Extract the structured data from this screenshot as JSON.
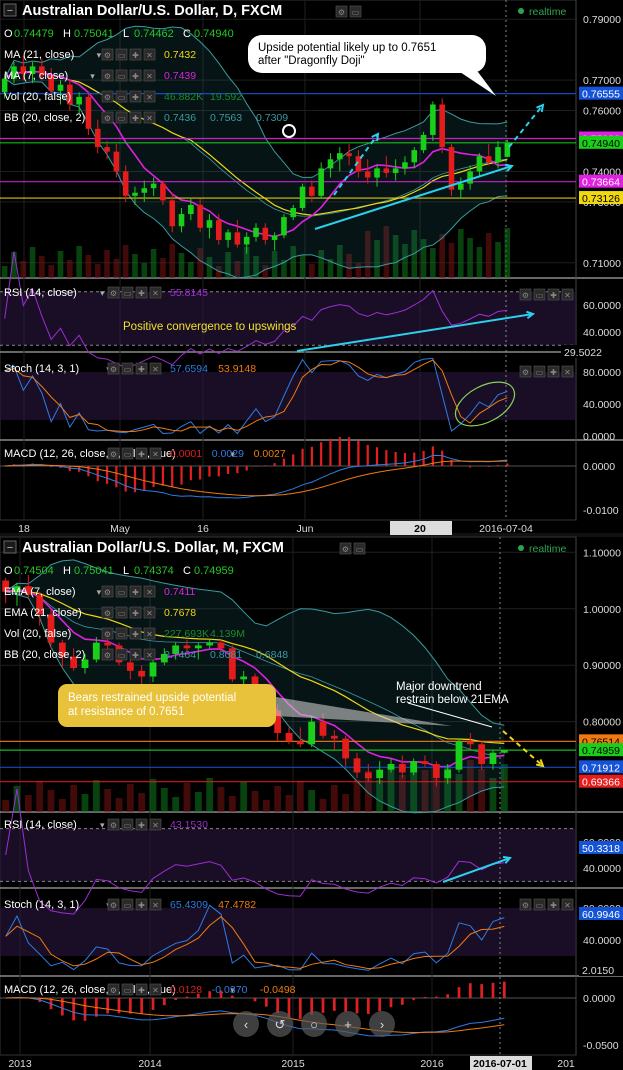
{
  "colors": {
    "bg": "#000000",
    "grid": "#1f1f1f",
    "sep": "#8a8a8a",
    "up": "#19cf19",
    "down": "#e41c1c",
    "ma21": "#f1d70f",
    "ma7": "#e020e0",
    "bb": "#3b9aa0",
    "rsi": "#9c2ed2",
    "stoch_k": "#2f7ce6",
    "stoch_d": "#f07a10",
    "macd": "#2f7ce6",
    "signal": "#f07a10",
    "hist": "#e02020",
    "vol": "#0f7a1c",
    "annot": "#2ad0ec",
    "yellow_arrow": "#f1d70f",
    "callout": "#e8c23a"
  },
  "daily": {
    "title": "Australian Dollar/U.S. Dollar, D, FXCM",
    "realtime": "realtime",
    "ohlc": {
      "O": "0.74479",
      "H": "0.75041",
      "L": "0.74462",
      "C": "0.74940"
    },
    "legend": [
      {
        "label": "MA (21, close)",
        "vals": [
          "0.7432"
        ],
        "colors": [
          "#f1d70f"
        ]
      },
      {
        "label": "MA (7, close)",
        "vals": [
          "0.7439"
        ],
        "colors": [
          "#e020e0"
        ]
      },
      {
        "label": "Vol (20, false)",
        "vals": [
          "46.882K",
          "19.592"
        ],
        "colors": [
          "#1b8a2a",
          "#1b8a2a"
        ]
      },
      {
        "label": "BB (20, close, 2)",
        "vals": [
          "0.7436",
          "0.7563",
          "0.7309"
        ],
        "colors": [
          "#3b9aa0",
          "#3b9aa0",
          "#3b9aa0"
        ]
      }
    ],
    "y_ticks": [
      "0.79000",
      "0.77000",
      "0.76000",
      "0.74000",
      "0.73000",
      "0.71000"
    ],
    "price_tags": [
      {
        "text": "0.76555",
        "bg": "#1452d8",
        "fg": "#ffffff",
        "v": 0.76555
      },
      {
        "text": "0.75082",
        "bg": "#e020e0",
        "fg": "#ffffff",
        "v": 0.75082
      },
      {
        "text": "0.74940",
        "bg": "#19cf19",
        "fg": "#000000",
        "v": 0.7494
      },
      {
        "text": "0.73664",
        "bg": "#e020e0",
        "fg": "#ffffff",
        "v": 0.73664
      },
      {
        "text": "0.73126",
        "bg": "#f1d70f",
        "fg": "#000000",
        "v": 0.73126
      }
    ],
    "hlines": [
      0.76555,
      0.75082,
      0.7494,
      0.73664,
      0.73126
    ],
    "callout": "Upside potential likely up to 0.7651\nafter \"Dragonfly Doji\"",
    "rsi": {
      "label": "RSI (14, close)",
      "value": "55.8145",
      "ticks": [
        "60.0000",
        "40.0000"
      ],
      "tag": "29.5022",
      "note": "Positive convergence to upswings"
    },
    "stoch": {
      "label": "Stoch (14, 3, 1)",
      "k": "57.6594",
      "d": "53.9148",
      "ticks": [
        "80.0000",
        "40.0000",
        "0.0000"
      ]
    },
    "macd": {
      "label": "MACD (12, 26, close, 9, false, true)",
      "v1": "0.0001",
      "v2": "0.0029",
      "v3": "0.0027",
      "ticks": [
        "0.0000",
        "-0.0100"
      ]
    },
    "x_labels": [
      "18",
      "May",
      "16",
      "Jun",
      "20",
      "2016-07-04"
    ]
  },
  "monthly": {
    "title": "Australian Dollar/U.S. Dollar, M, FXCM",
    "realtime": "realtime",
    "ohlc": {
      "O": "0.74504",
      "H": "0.75041",
      "L": "0.74374",
      "C": "0.74959"
    },
    "legend": [
      {
        "label": "EMA (7, close)",
        "vals": [
          "0.7411"
        ],
        "colors": [
          "#e020e0"
        ]
      },
      {
        "label": "EMA (21, close)",
        "vals": [
          "0.7678"
        ],
        "colors": [
          "#f1d70f"
        ]
      },
      {
        "label": "Vol (20, false)",
        "vals": [
          "227.693K",
          "4.139M"
        ],
        "colors": [
          "#1b8a2a",
          "#1b8a2a"
        ]
      },
      {
        "label": "BB (20, close, 2)",
        "vals": [
          "0.7464",
          "0.8081",
          "0.6848"
        ],
        "colors": [
          "#3b9aa0",
          "#3b9aa0",
          "#3b9aa0"
        ]
      }
    ],
    "y_ticks": [
      "1.10000",
      "1.00000",
      "0.90000",
      "0.80000"
    ],
    "price_tags": [
      {
        "text": "0.76514",
        "bg": "#f07a10",
        "fg": "#000000",
        "v": 0.76514
      },
      {
        "text": "0.74959",
        "bg": "#19cf19",
        "fg": "#000000",
        "v": 0.74959
      },
      {
        "text": "0.71912",
        "bg": "#1452d8",
        "fg": "#ffffff",
        "v": 0.71912
      },
      {
        "text": "0.69366",
        "bg": "#e41c1c",
        "fg": "#ffffff",
        "v": 0.69366
      }
    ],
    "hlines": [
      0.76514,
      0.74959,
      0.71912,
      0.69366
    ],
    "callout": "Bears restrained upside potential\nat resistance of 0.7651",
    "note": "Major downtrend\nrestrain below 21EMA",
    "rsi": {
      "label": "RSI (14, close)",
      "value": "43.1530",
      "ticks": [
        "60.0000",
        "40.0000"
      ],
      "tag": "50.3318"
    },
    "stoch": {
      "label": "Stoch (14, 3, 1)",
      "k": "65.4309",
      "d": "47.4782",
      "ticks": [
        "80.0000",
        "40.0000"
      ],
      "tag": "60.9946",
      "tag2": "2.0150"
    },
    "macd": {
      "label": "MACD (12, 26, close, 9, false, true)",
      "v1": "0.0128",
      "v2": "-0.0370",
      "v3": "-0.0498",
      "ticks": [
        "0.0000",
        "-0.0500"
      ]
    },
    "x_labels": [
      "2013",
      "2014",
      "2015",
      "2016",
      "2016-07-01",
      "201"
    ]
  },
  "chart_data": [
    {
      "type": "candlestick",
      "title": "Australian Dollar/U.S. Dollar, D, FXCM",
      "ylim": [
        0.705,
        0.795
      ],
      "candles": [
        [
          0.766,
          0.772,
          0.764,
          0.7705
        ],
        [
          0.7705,
          0.776,
          0.769,
          0.7745
        ],
        [
          0.7745,
          0.778,
          0.77,
          0.772
        ],
        [
          0.772,
          0.776,
          0.769,
          0.7745
        ],
        [
          0.7745,
          0.777,
          0.77,
          0.7715
        ],
        [
          0.7715,
          0.774,
          0.765,
          0.7665
        ],
        [
          0.7665,
          0.77,
          0.762,
          0.7685
        ],
        [
          0.7685,
          0.77,
          0.76,
          0.762
        ],
        [
          0.762,
          0.766,
          0.759,
          0.7645
        ],
        [
          0.7645,
          0.766,
          0.752,
          0.754
        ],
        [
          0.754,
          0.757,
          0.746,
          0.748
        ],
        [
          0.748,
          0.75,
          0.744,
          0.7465
        ],
        [
          0.7465,
          0.749,
          0.738,
          0.74
        ],
        [
          0.74,
          0.742,
          0.73,
          0.732
        ],
        [
          0.732,
          0.735,
          0.729,
          0.733
        ],
        [
          0.733,
          0.737,
          0.73,
          0.7345
        ],
        [
          0.7345,
          0.738,
          0.732,
          0.736
        ],
        [
          0.736,
          0.737,
          0.729,
          0.7305
        ],
        [
          0.7305,
          0.733,
          0.72,
          0.722
        ],
        [
          0.722,
          0.728,
          0.72,
          0.726
        ],
        [
          0.726,
          0.731,
          0.724,
          0.729
        ],
        [
          0.729,
          0.731,
          0.72,
          0.7215
        ],
        [
          0.7215,
          0.726,
          0.718,
          0.724
        ],
        [
          0.724,
          0.726,
          0.716,
          0.7175
        ],
        [
          0.7175,
          0.721,
          0.715,
          0.72
        ],
        [
          0.72,
          0.724,
          0.715,
          0.716
        ],
        [
          0.716,
          0.72,
          0.713,
          0.7185
        ],
        [
          0.7185,
          0.723,
          0.717,
          0.7215
        ],
        [
          0.7215,
          0.723,
          0.716,
          0.7175
        ],
        [
          0.7175,
          0.72,
          0.714,
          0.719
        ],
        [
          0.719,
          0.726,
          0.718,
          0.725
        ],
        [
          0.725,
          0.729,
          0.724,
          0.728
        ],
        [
          0.728,
          0.736,
          0.727,
          0.735
        ],
        [
          0.735,
          0.737,
          0.73,
          0.732
        ],
        [
          0.732,
          0.743,
          0.731,
          0.741
        ],
        [
          0.741,
          0.746,
          0.738,
          0.744
        ],
        [
          0.744,
          0.748,
          0.74,
          0.746
        ],
        [
          0.746,
          0.749,
          0.742,
          0.745
        ],
        [
          0.745,
          0.747,
          0.738,
          0.74
        ],
        [
          0.74,
          0.744,
          0.736,
          0.738
        ],
        [
          0.738,
          0.742,
          0.735,
          0.741
        ],
        [
          0.741,
          0.745,
          0.738,
          0.7395
        ],
        [
          0.7395,
          0.744,
          0.737,
          0.741
        ],
        [
          0.741,
          0.745,
          0.739,
          0.743
        ],
        [
          0.743,
          0.748,
          0.741,
          0.747
        ],
        [
          0.747,
          0.753,
          0.746,
          0.752
        ],
        [
          0.752,
          0.763,
          0.75,
          0.762
        ],
        [
          0.762,
          0.764,
          0.746,
          0.748
        ],
        [
          0.748,
          0.749,
          0.732,
          0.734
        ],
        [
          0.734,
          0.738,
          0.731,
          0.736
        ],
        [
          0.736,
          0.742,
          0.734,
          0.74
        ],
        [
          0.74,
          0.746,
          0.738,
          0.745
        ],
        [
          0.745,
          0.749,
          0.742,
          0.743
        ],
        [
          0.743,
          0.75,
          0.741,
          0.748
        ],
        [
          0.7448,
          0.7504,
          0.7446,
          0.7494
        ]
      ]
    },
    {
      "type": "candlestick",
      "title": "Australian Dollar/U.S. Dollar, M, FXCM",
      "ylim": [
        0.64,
        1.12
      ],
      "candles": [
        [
          1.05,
          1.055,
          1.01,
          1.03
        ],
        [
          1.03,
          1.045,
          1.005,
          1.04
        ],
        [
          1.04,
          1.06,
          1.02,
          1.025
        ],
        [
          1.025,
          1.03,
          0.97,
          0.99
        ],
        [
          0.99,
          1.0,
          0.93,
          0.94
        ],
        [
          0.94,
          0.945,
          0.895,
          0.915
        ],
        [
          0.915,
          0.93,
          0.89,
          0.895
        ],
        [
          0.895,
          0.92,
          0.885,
          0.91
        ],
        [
          0.91,
          0.95,
          0.905,
          0.94
        ],
        [
          0.94,
          0.955,
          0.925,
          0.935
        ],
        [
          0.935,
          0.94,
          0.9,
          0.905
        ],
        [
          0.905,
          0.91,
          0.875,
          0.89
        ],
        [
          0.89,
          0.9,
          0.865,
          0.88
        ],
        [
          0.88,
          0.915,
          0.87,
          0.905
        ],
        [
          0.905,
          0.93,
          0.9,
          0.92
        ],
        [
          0.92,
          0.94,
          0.91,
          0.935
        ],
        [
          0.935,
          0.945,
          0.925,
          0.93
        ],
        [
          0.93,
          0.94,
          0.91,
          0.935
        ],
        [
          0.935,
          0.945,
          0.93,
          0.94
        ],
        [
          0.94,
          0.945,
          0.925,
          0.93
        ],
        [
          0.93,
          0.935,
          0.87,
          0.875
        ],
        [
          0.875,
          0.89,
          0.86,
          0.88
        ],
        [
          0.88,
          0.885,
          0.855,
          0.86
        ],
        [
          0.86,
          0.865,
          0.81,
          0.82
        ],
        [
          0.82,
          0.83,
          0.765,
          0.78
        ],
        [
          0.78,
          0.79,
          0.76,
          0.765
        ],
        [
          0.765,
          0.79,
          0.755,
          0.76
        ],
        [
          0.76,
          0.81,
          0.755,
          0.8
        ],
        [
          0.8,
          0.815,
          0.77,
          0.775
        ],
        [
          0.775,
          0.785,
          0.75,
          0.77
        ],
        [
          0.77,
          0.775,
          0.72,
          0.735
        ],
        [
          0.735,
          0.745,
          0.7,
          0.71
        ],
        [
          0.71,
          0.725,
          0.695,
          0.7
        ],
        [
          0.7,
          0.73,
          0.69,
          0.715
        ],
        [
          0.715,
          0.735,
          0.71,
          0.725
        ],
        [
          0.725,
          0.74,
          0.7,
          0.71
        ],
        [
          0.71,
          0.735,
          0.705,
          0.73
        ],
        [
          0.73,
          0.74,
          0.72,
          0.725
        ],
        [
          0.725,
          0.73,
          0.685,
          0.7
        ],
        [
          0.7,
          0.725,
          0.69,
          0.715
        ],
        [
          0.715,
          0.77,
          0.71,
          0.765
        ],
        [
          0.765,
          0.78,
          0.75,
          0.76
        ],
        [
          0.76,
          0.765,
          0.715,
          0.725
        ],
        [
          0.725,
          0.75,
          0.715,
          0.745
        ],
        [
          0.745,
          0.7504,
          0.7437,
          0.7496
        ]
      ]
    }
  ]
}
